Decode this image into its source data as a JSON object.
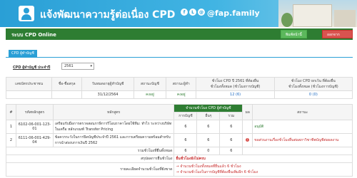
{
  "banner": {
    "title": "แจ้งพัฒนาความรู้ต่อเนื่อง CPD",
    "social_icons": [
      "facebook-icon",
      "line-icon",
      "email-icon"
    ],
    "handle": "@fap.family"
  },
  "topbar": {
    "system_title": "ระบบ CPD Online",
    "print_label": "พิมพ์หน้านี้",
    "logout_label": "ออกจากระบบ"
  },
  "tab": {
    "label": "CPD ผู้ทำบัญชี"
  },
  "account": {
    "label": "CPD ผู้ทำบัญชี ประจำปี",
    "year": "2561"
  },
  "summary": {
    "headers": [
      "เลขบัตรประชาชน",
      "ชื่อ-ชื่อสกุล",
      "วันหมดอายุผู้ทำบัญชี",
      "สถานะบัญชี",
      "สถานะผู้ทำ",
      "ชั่วโมง CPD ปี 2561 ที่ต้องยื่น\nชั่วโมงทั้งหมด (ชั่วโมงการบัญชี)",
      "ชั่วโมง CPD ยกเว้น ที่ต้องยื่น\nชั่วโมงทั้งหมด (ชั่วโมงการบัญชี)"
    ],
    "row": [
      "",
      "",
      "31/12/2564",
      "คงอยู่",
      "คงอยู่",
      "12 (6)",
      "0 (0)"
    ]
  },
  "detail": {
    "headers": {
      "no": "#",
      "code": "รหัสหลักสูตร",
      "course": "หลักสูตร",
      "group": "จำนวนชั่วโมง CPD ผู้ทำบัญชี",
      "acct": "การบัญชี",
      "other": "อื่นๆ",
      "total": "รวม",
      "flag": "ผล",
      "status": "สถานะ"
    },
    "rows": [
      {
        "no": "1",
        "code": "6102-06-001-123-01",
        "course": "เตรียมรับมือการตรวจสอบภาษีการรีโอนราคาโดยใช้ทีม: ทำไร ระหว่างบริษัทในเครือ หลักเกณฑ์ Transfer Pricing",
        "acct": "6",
        "other": "6",
        "total": "6",
        "status": "อนุมัติ"
      },
      {
        "no": "2",
        "code": "6111-06-001-429-04",
        "course": "ข้อควรระวังในการปิดบัญชีประจำปี 2561 และการเตรียมความพร้อมสำหรับการนำส่งงบการเงินปี 2562",
        "acct": "6",
        "other": "6",
        "total": "6",
        "status": "ขอส่วนงานเรื่องชั่วโมงยื่นต่อสภาวิชาชีพบัญชีต่อผลงาน"
      }
    ],
    "total_label": "รวมชั่วโมงที่ยื่นทั้งหมด",
    "total_values": [
      "6",
      "0",
      "6"
    ],
    "result_label": "สรุปผลการยื่นชั่วโมง",
    "result_text": "ยื่นชั่วโมงยังไม่ครบ",
    "notes_label": "รายละเอียดจำนวนชั่วโมงที่ยังขาด",
    "notes": [
      "→ จำนวนชั่วโมงทั้งหมดที่ยื่นแล้ว 6 ชั่วโมง",
      "→ จำนวนชั่วโมงในการบัญชีที่ต้องยื่นเพิ่มอีก 6 ชั่วโมง"
    ]
  }
}
